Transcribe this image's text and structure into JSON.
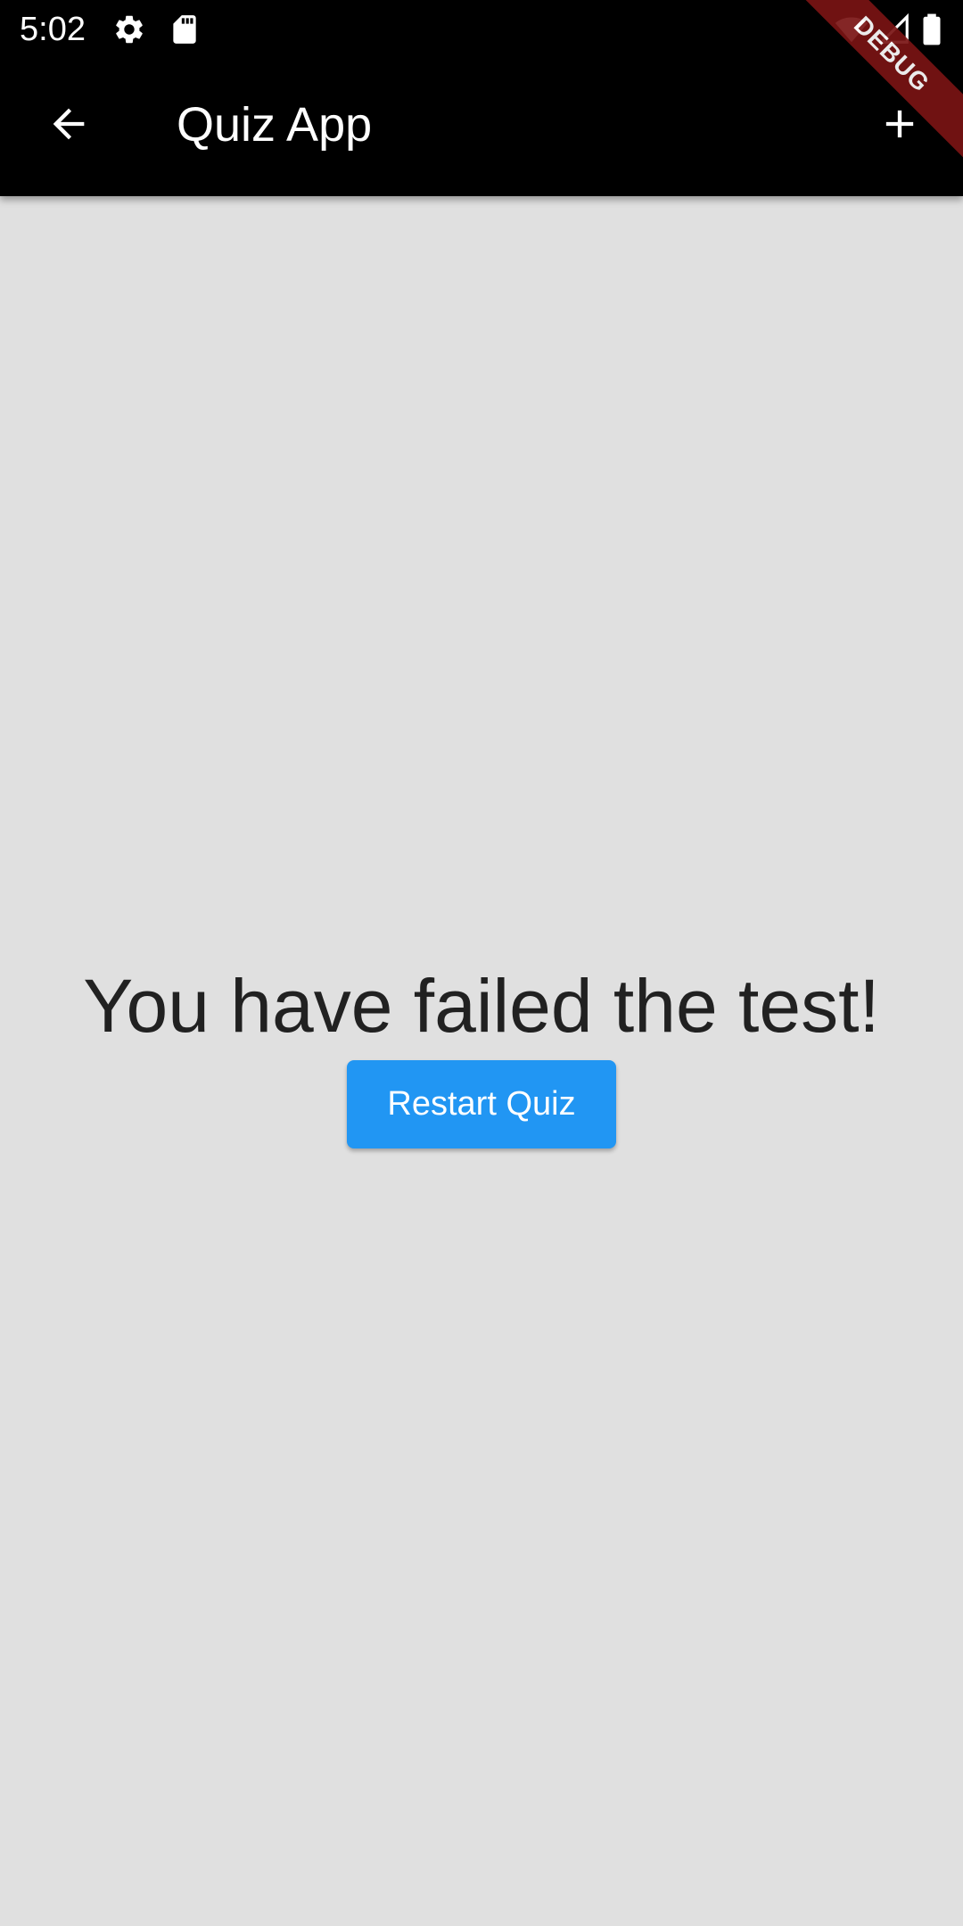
{
  "status_bar": {
    "time": "5:02",
    "icons": [
      "settings-icon",
      "sd-card-icon",
      "wifi-icon",
      "signal-icon",
      "battery-icon"
    ]
  },
  "app_bar": {
    "title": "Quiz App",
    "back_icon": "arrow-back-icon",
    "action_icon": "add-icon"
  },
  "debug_banner": {
    "label": "DEBUG"
  },
  "content": {
    "message": "You have failed the test!",
    "restart_label": "Restart Quiz"
  },
  "colors": {
    "app_bar": "#000000",
    "background": "#e0e0e0",
    "button": "#2196f3",
    "message_text": "#212121",
    "debug_banner": "#7a1414"
  }
}
